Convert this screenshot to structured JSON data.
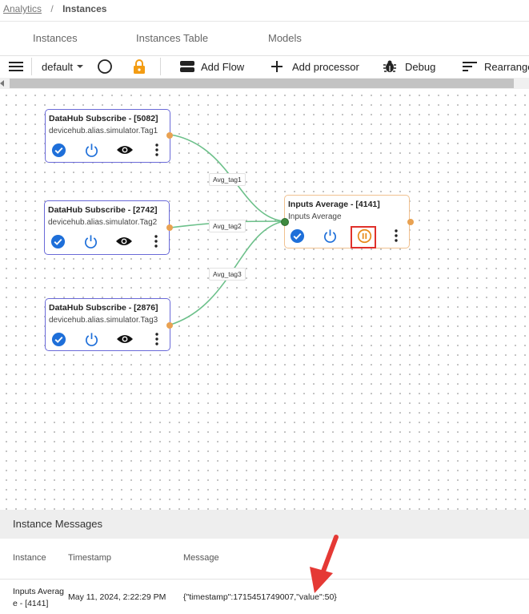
{
  "breadcrumb": {
    "root": "Analytics",
    "separator": "/",
    "current": "Instances"
  },
  "tabs": [
    {
      "label": "Instances"
    },
    {
      "label": "Instances Table"
    },
    {
      "label": "Models"
    }
  ],
  "toolbar": {
    "menu_icon": "hamburger-icon",
    "flow_select": "default",
    "add_flow": "Add Flow",
    "add_processor": "Add processor",
    "debug": "Debug",
    "rearrange": "Rearrange",
    "lock_color": "#f39c12"
  },
  "nodes": [
    {
      "title": "DataHub Subscribe - [5082]",
      "subtitle": "devicehub.alias.simulator.Tag1"
    },
    {
      "title": "DataHub Subscribe - [2742]",
      "subtitle": "devicehub.alias.simulator.Tag2"
    },
    {
      "title": "DataHub Subscribe - [2876]",
      "subtitle": "devicehub.alias.simulator.Tag3"
    },
    {
      "title": "Inputs Average - [4141]",
      "subtitle": "Inputs Average"
    }
  ],
  "edges": [
    {
      "label": "Avg_tag1"
    },
    {
      "label": "Avg_tag2"
    },
    {
      "label": "Avg_tag3"
    }
  ],
  "colors": {
    "accent_blue": "#1e6fd9",
    "edge_green": "#6cc08a",
    "port_orange": "#e9a252",
    "node_border": "#6a6ad8",
    "selected_border": "#f0c190",
    "highlight_red": "#e0312b",
    "pause_orange": "#e88a1a"
  },
  "messages": {
    "title": "Instance Messages",
    "columns": [
      "Instance",
      "Timestamp",
      "Message"
    ],
    "rows": [
      {
        "instance_line1": "Inputs Averag",
        "instance_line2": "e - [4141]",
        "timestamp": "May 11, 2024, 2:22:29 PM",
        "message": "{\"timestamp\":1715451749007,\"value\":50}"
      }
    ]
  }
}
